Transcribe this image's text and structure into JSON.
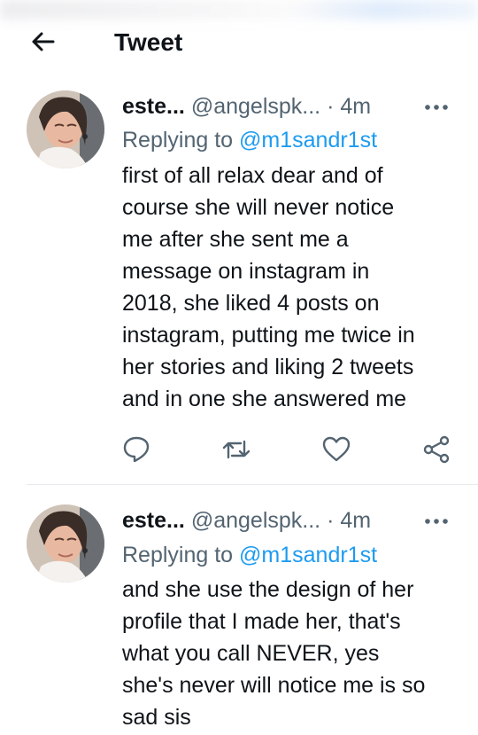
{
  "header": {
    "title": "Tweet"
  },
  "tweets": [
    {
      "display_name": "este...",
      "handle": "@angelspk...",
      "separator": "·",
      "time": "4m",
      "replying_prefix": "Replying to",
      "replying_to": "@m1sandr1st",
      "lines": [
        "first of all relax dear and of",
        "course she will never notice",
        "me after she sent me a",
        "message on instagram in",
        "2018, she liked 4 posts on",
        "instagram, putting me twice in",
        "her stories and liking 2 tweets",
        "and in one she answered me"
      ]
    },
    {
      "display_name": "este...",
      "handle": "@angelspk...",
      "separator": "·",
      "time": "4m",
      "replying_prefix": "Replying to",
      "replying_to": "@m1sandr1st",
      "lines": [
        "and she use the design of her",
        "profile that I made her, that's",
        "what you call NEVER, yes",
        "she's never will notice me is so",
        "sad sis"
      ]
    }
  ],
  "icons": {
    "back": "arrow-left-icon",
    "more": "more-dots-icon",
    "reply": "reply-icon",
    "retweet": "retweet-icon",
    "like": "heart-icon",
    "share": "share-icon"
  },
  "colors": {
    "accent": "#1d9bf0",
    "text": "#0f1419",
    "muted": "#536471",
    "icon": "#536471"
  }
}
